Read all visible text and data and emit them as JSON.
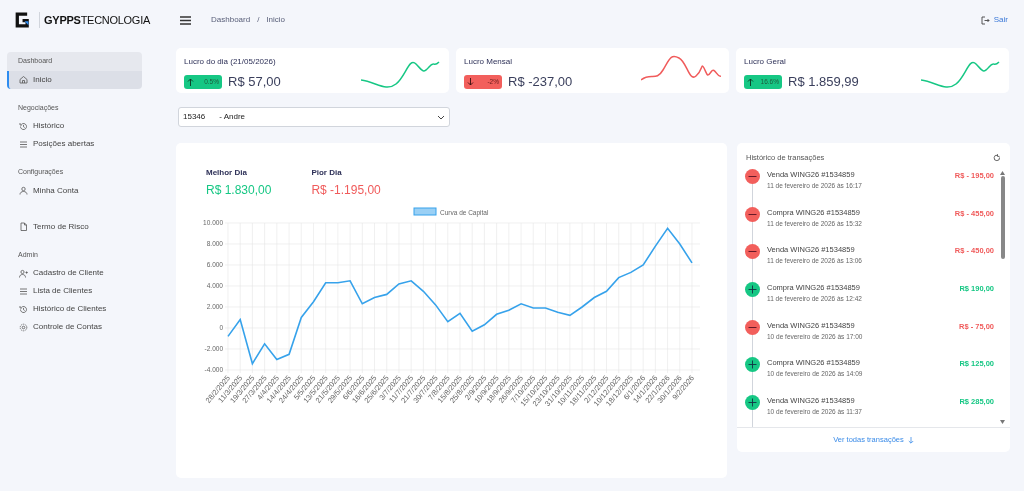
{
  "brand": {
    "name": "**GYPPS**TECNOLOGIA"
  },
  "breadcrumb": [
    "Dashboard",
    "Inicio"
  ],
  "breadcrumb_separator": "/",
  "logout": "Sair",
  "sidebar": [
    {
      "heading": "Dashboard",
      "items": [
        {
          "label": "Inicio",
          "selected": true
        }
      ]
    },
    {
      "heading": "Negociações",
      "items": [
        {
          "label": "Histórico",
          "selected": false
        },
        {
          "label": "Posições abertas",
          "selected": false
        }
      ]
    },
    {
      "heading": "Configurações",
      "items": [
        {
          "label": "Minha Conta",
          "selected": false
        }
      ]
    },
    {
      "items": [
        {
          "label": "Termo de Risco",
          "selected": false
        }
      ]
    },
    {
      "heading": "Admin",
      "items": [
        {
          "label": "Cadastro de Cliente",
          "selected": false
        },
        {
          "label": "Lista de Clientes",
          "selected": false
        },
        {
          "label": "Histórico de Clientes",
          "selected": false
        },
        {
          "label": "Controle de Contas",
          "selected": false
        }
      ]
    }
  ],
  "stats": [
    {
      "title": "Lucro do dia (21/05/2026)",
      "kind": "up",
      "change": "0.5%",
      "value": "R$ 57,00"
    },
    {
      "title": "Lucro Mensal",
      "kind": "down",
      "change": "-2%",
      "value": "R$ -237,00"
    },
    {
      "title": "Lucro Geral",
      "kind": "up",
      "change": "16.6%",
      "value": "R$ 1.859,99"
    }
  ],
  "account_select": {
    "id": "15346",
    "name": "- Andre"
  },
  "performance": {
    "best_label": "Melhor Dia",
    "best_value": "R$ 1.830,00",
    "worst_label": "Pior Dia",
    "worst_value": "R$ -1.195,00",
    "chart_data": {
      "type": "line",
      "grid": true,
      "categories": [
        "28/2/2025",
        "11/3/2025",
        "19/3/2025",
        "27/3/2025",
        "4/4/2025",
        "14/4/2025",
        "24/4/2025",
        "5/5/2025",
        "13/5/2025",
        "21/5/2025",
        "29/5/2025",
        "6/6/2025",
        "16/6/2025",
        "25/6/2025",
        "3/7/2025",
        "11/7/2025",
        "21/7/2025",
        "30/7/2025",
        "7/8/2025",
        "15/8/2025",
        "25/8/2025",
        "2/9/2025",
        "10/9/2025",
        "18/9/2025",
        "26/9/2025",
        "7/10/2025",
        "15/10/2025",
        "23/10/2025",
        "31/10/2025",
        "10/11/2025",
        "18/11/2025",
        "2/12/2025",
        "10/12/2025",
        "18/12/2025",
        "6/1/2026",
        "14/1/2026",
        "22/1/2026",
        "30/1/2026",
        "9/2/2026"
      ],
      "series": [
        {
          "name": "Curva de Capital",
          "color": "#36a2eb",
          "values": [
            -800,
            800,
            -3400,
            -1500,
            -3000,
            -2500,
            1000,
            2500,
            4300,
            4300,
            4500,
            2300,
            2900,
            3200,
            4200,
            4500,
            3500,
            2200,
            600,
            1400,
            -300,
            300,
            1300,
            1700,
            2300,
            1900,
            1900,
            1500,
            1200,
            2000,
            2900,
            3500,
            4800,
            5300,
            6000,
            7800,
            9500,
            8000,
            6200
          ]
        }
      ],
      "ylim": [
        -4000,
        10000
      ],
      "yticks": [
        {
          "value": -4000,
          "label": "-4.000"
        },
        {
          "value": -2000,
          "label": "-2.000"
        },
        {
          "value": 0,
          "label": "0"
        },
        {
          "value": 2000,
          "label": "2.000"
        },
        {
          "value": 4000,
          "label": "4.000"
        },
        {
          "value": 6000,
          "label": "6.000"
        },
        {
          "value": 8000,
          "label": "8.000"
        },
        {
          "value": 10000,
          "label": "10.000"
        }
      ]
    }
  },
  "transactions": {
    "title": "Histórico de transações",
    "footer": "Ver todas transações",
    "items": [
      {
        "kind": "minus",
        "label": "Venda WING26 #1534859",
        "date": "11 de fevereiro de 2026 às 16:17",
        "amount": "R$ - 195,00"
      },
      {
        "kind": "minus",
        "label": "Compra WING26 #1534859",
        "date": "11 de fevereiro de 2026 às 15:32",
        "amount": "R$ - 455,00"
      },
      {
        "kind": "minus",
        "label": "Venda WING26 #1534859",
        "date": "11 de fevereiro de 2026 às 13:06",
        "amount": "R$ - 450,00"
      },
      {
        "kind": "plus",
        "label": "Compra WING26 #1534859",
        "date": "11 de fevereiro de 2026 às 12:42",
        "amount": "R$ 190,00"
      },
      {
        "kind": "minus",
        "label": "Venda WING26 #1534859",
        "date": "10 de fevereiro de 2026 às 17:00",
        "amount": "R$ - 75,00"
      },
      {
        "kind": "plus",
        "label": "Compra WING26 #1534859",
        "date": "10 de fevereiro de 2026 às 14:09",
        "amount": "R$ 125,00"
      },
      {
        "kind": "plus",
        "label": "Venda WING26 #1534859",
        "date": "10 de fevereiro de 2026 às 11:37",
        "amount": "R$ 285,00"
      }
    ]
  }
}
